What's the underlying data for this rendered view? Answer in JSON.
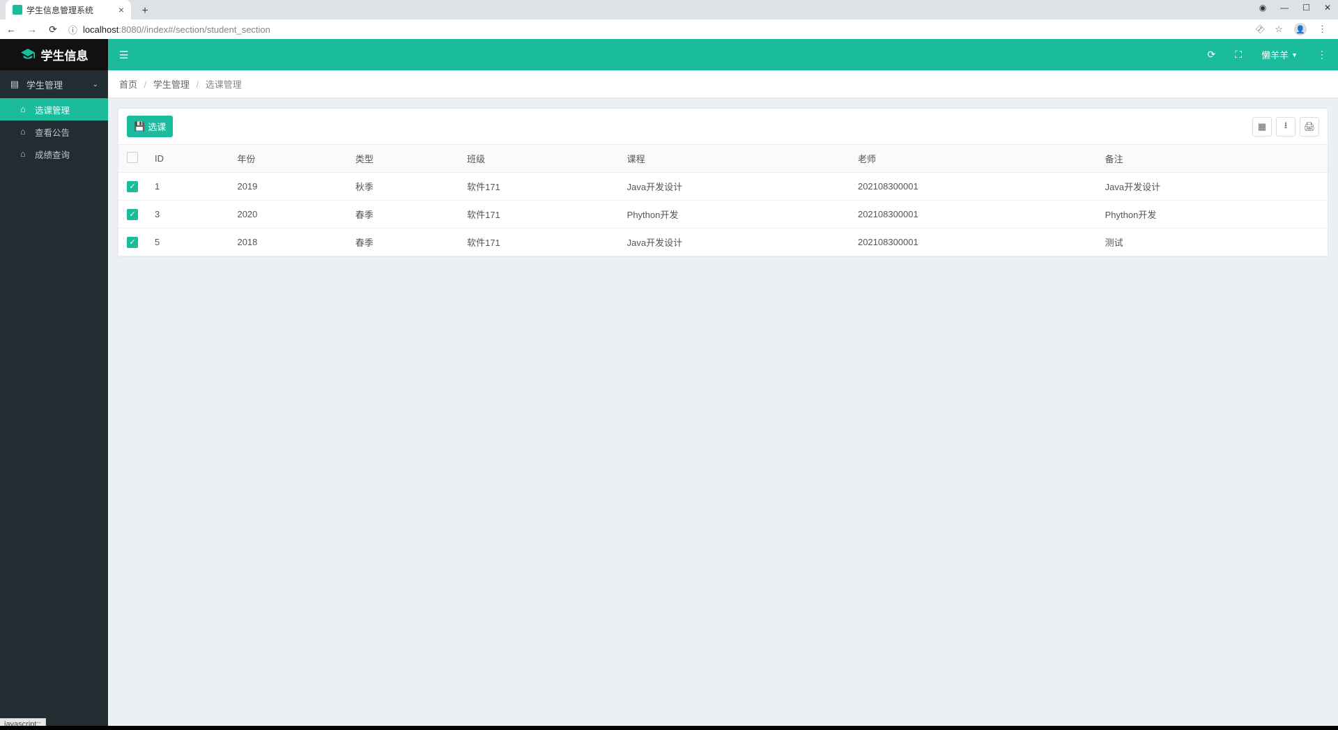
{
  "browser": {
    "tab_title": "学生信息管理系统",
    "url_host": "localhost",
    "url_port": ":8080",
    "url_path": "//index#/section/student_section",
    "status_hint": "javascript:;"
  },
  "app": {
    "logo_text": "学生信息"
  },
  "sidebar": {
    "parent_label": "学生管理",
    "items": [
      {
        "label": "选课管理",
        "active": true
      },
      {
        "label": "查看公告",
        "active": false
      },
      {
        "label": "成绩查询",
        "active": false
      }
    ]
  },
  "header": {
    "username": "懒羊羊"
  },
  "breadcrumb": {
    "home": "首页",
    "lvl1": "学生管理",
    "cur": "选课管理"
  },
  "toolbar": {
    "select_button": "选课"
  },
  "table": {
    "headers": {
      "id": "ID",
      "year": "年份",
      "type": "类型",
      "class": "班级",
      "course": "课程",
      "teacher": "老师",
      "remark": "备注"
    },
    "rows": [
      {
        "checked": true,
        "id": "1",
        "year": "2019",
        "type": "秋季",
        "class": "软件171",
        "course": "Java开发设计",
        "teacher": "202108300001",
        "remark": "Java开发设计"
      },
      {
        "checked": true,
        "id": "3",
        "year": "2020",
        "type": "春季",
        "class": "软件171",
        "course": "Phython开发",
        "teacher": "202108300001",
        "remark": "Phython开发"
      },
      {
        "checked": true,
        "id": "5",
        "year": "2018",
        "type": "春季",
        "class": "软件171",
        "course": "Java开发设计",
        "teacher": "202108300001",
        "remark": "测试"
      }
    ]
  }
}
